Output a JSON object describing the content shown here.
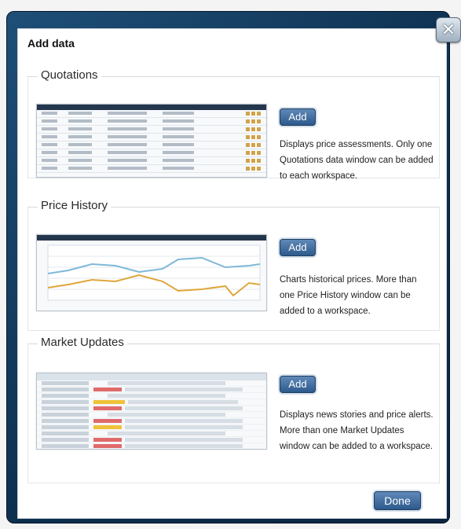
{
  "dialog": {
    "title": "Add data",
    "done_label": "Done",
    "close_icon": "close-icon"
  },
  "sections": {
    "quotations": {
      "heading": "Quotations",
      "add_label": "Add",
      "description": "Displays price assessments. Only one Quotations data window can be added to each workspace."
    },
    "price_history": {
      "heading": "Price History",
      "add_label": "Add",
      "description": "Charts historical prices. More than one Price History window can be added to a workspace."
    },
    "market_updates": {
      "heading": "Market Updates",
      "add_label": "Add",
      "description": "Displays news stories and price alerts. More than one Market Updates window can be added to a workspace."
    }
  },
  "colors": {
    "frame": "#0d2f4e",
    "button": "#2d5a8c",
    "chart_blue": "#7fb8d8",
    "chart_orange": "#e0a63b",
    "alert_red": "#e06a6a",
    "alert_yellow": "#f0c23a"
  }
}
